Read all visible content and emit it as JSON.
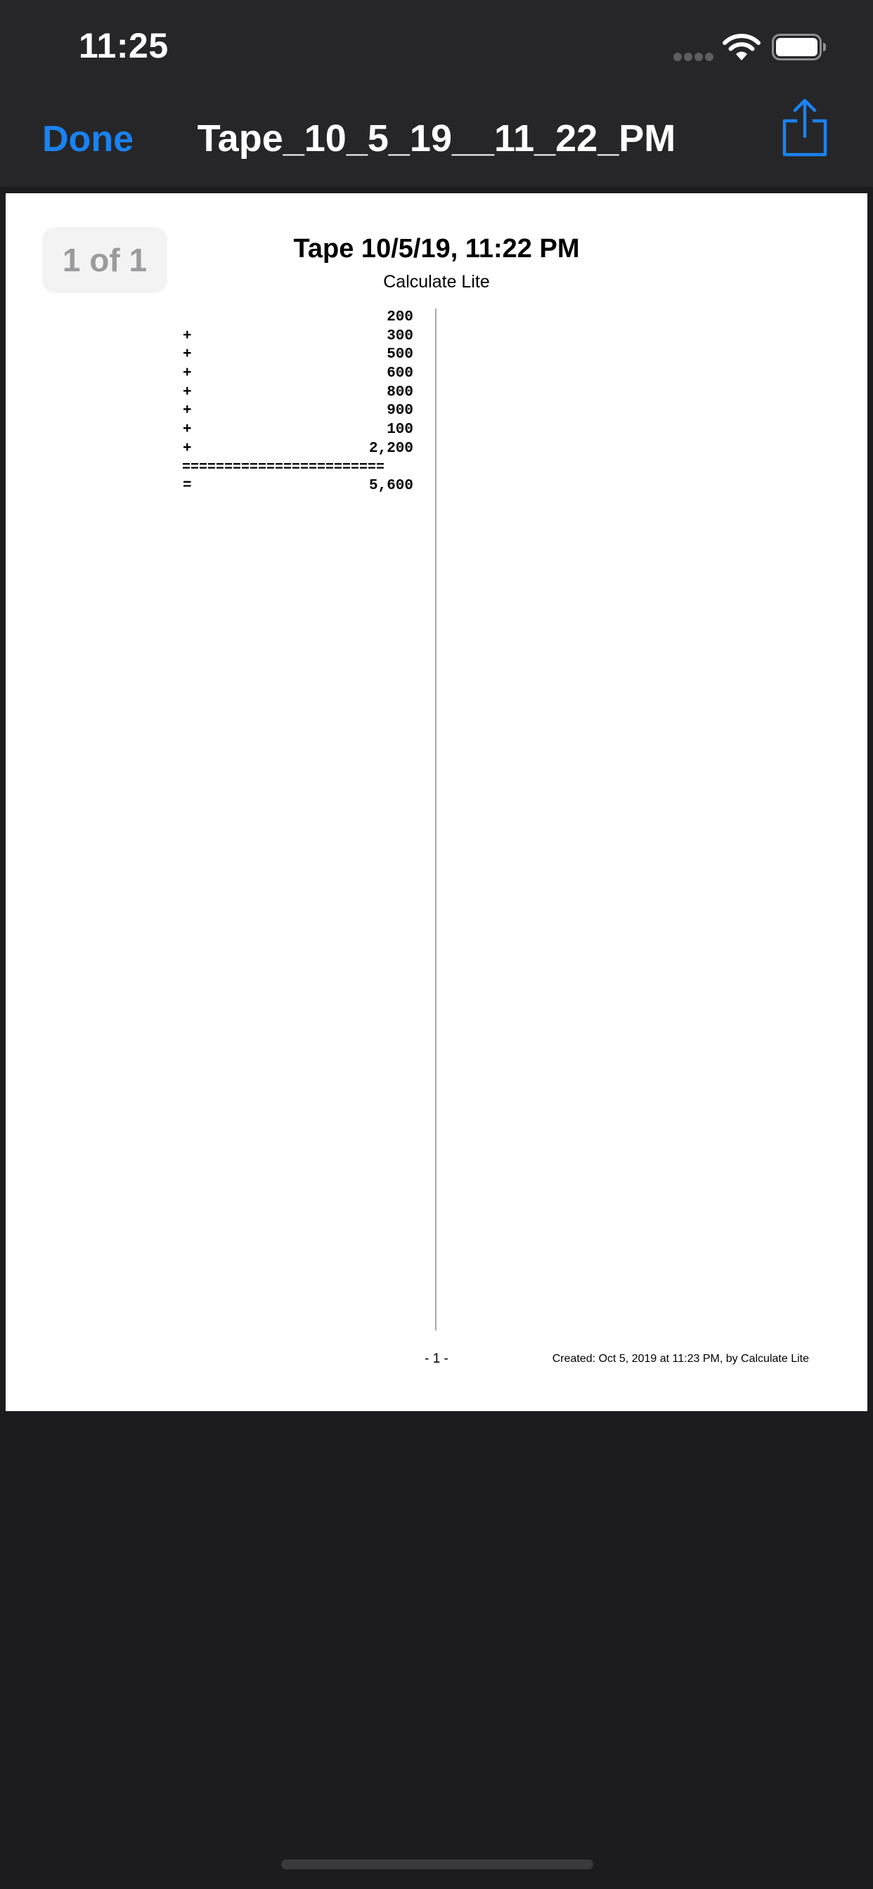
{
  "status_bar": {
    "time": "11:25"
  },
  "nav": {
    "done_label": "Done",
    "title": "Tape_10_5_19__11_22_PM",
    "share_icon": "share-icon",
    "accent_color": "#1a82f0"
  },
  "document": {
    "page_counter": "1 of 1",
    "title": "Tape 10/5/19, 11:22 PM",
    "subtitle": "Calculate Lite",
    "tape": [
      {
        "op": "",
        "value": "200"
      },
      {
        "op": "+",
        "value": "300"
      },
      {
        "op": "+",
        "value": "500"
      },
      {
        "op": "+",
        "value": "600"
      },
      {
        "op": "+",
        "value": "800"
      },
      {
        "op": "+",
        "value": "900"
      },
      {
        "op": "+",
        "value": "100"
      },
      {
        "op": "+",
        "value": "2,200"
      }
    ],
    "separator": "========================",
    "total": {
      "op": "=",
      "value": "5,600"
    },
    "page_number": "- 1 -",
    "footer": "Created: Oct 5, 2019 at 11:23 PM, by Calculate Lite"
  }
}
